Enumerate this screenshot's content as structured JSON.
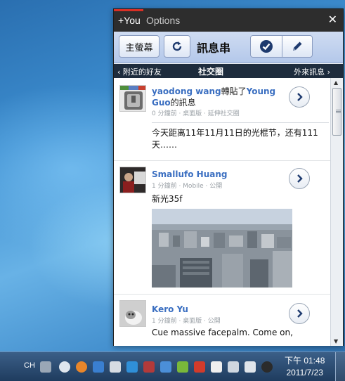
{
  "window": {
    "brand": "+You",
    "options": "Options",
    "close_symbol": "✕"
  },
  "toolbar": {
    "home_label": "主螢幕",
    "title": "訊息串"
  },
  "navbar": {
    "left": "‹ 附近的好友",
    "center": "社交圈",
    "right": "外來訊息 ›"
  },
  "posts": [
    {
      "author": "yaodong wang",
      "action": "轉貼了",
      "target": "Young Guo",
      "target_suffix": "的訊息",
      "meta": "0 分鐘前 · 桌面版 · 延伸社交圈",
      "text": "今天距离11年11月11日的光棍节，还有111天……"
    },
    {
      "author": "Smallufo Huang",
      "meta": "1 分鐘前 · Mobile · 公開",
      "text": "新光35f"
    },
    {
      "author": "Kero Yu",
      "meta": "1 分鐘前 · 桌面版 · 公開",
      "text": "Cue massive facepalm. Come on,"
    }
  ],
  "taskbar": {
    "language": "CH",
    "time": "下午 01:48",
    "date": "2011/7/23"
  },
  "colors": {
    "accent_red": "#d93025",
    "link_blue": "#3b6fc1",
    "titlebar": "#2d2d2d",
    "navbar": "#1e2c3d"
  },
  "icons": [
    "refresh-icon",
    "check-icon",
    "pencil-icon",
    "chevron-right-icon",
    "close-icon",
    "scroll-up-icon",
    "scroll-down-icon"
  ]
}
